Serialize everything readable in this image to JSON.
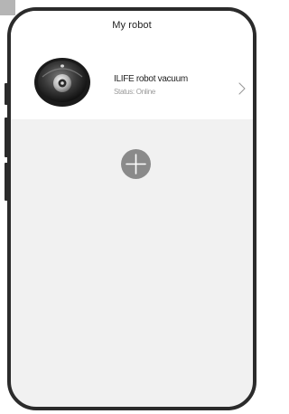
{
  "header": {
    "title": "My robot"
  },
  "robot": {
    "name": "ILIFE robot vacuum",
    "status": "Status: Online",
    "image_icon": "robot-vacuum-icon",
    "nav_icon": "chevron-right-icon"
  },
  "add_device": {
    "icon": "plus-icon"
  },
  "colors": {
    "frame": "#2b2b2b",
    "screen_background": "#f1f1f1",
    "card_background": "#ffffff",
    "title_text": "#222222",
    "status_text": "#9a9a9a",
    "add_button": "#8a8a8a"
  }
}
